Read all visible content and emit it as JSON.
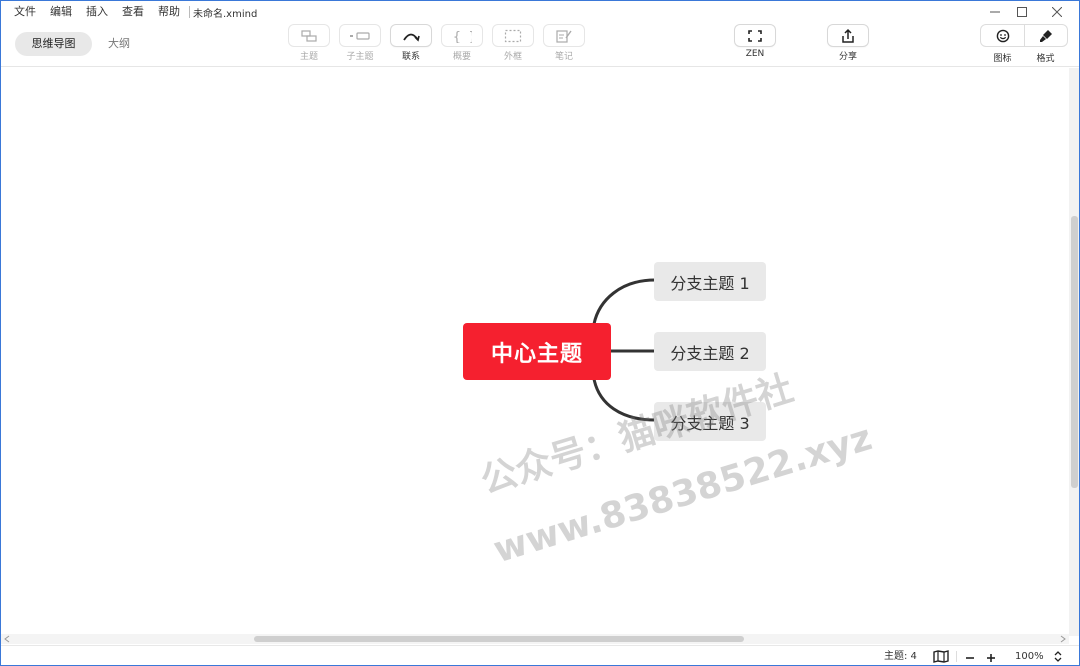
{
  "menubar": {
    "items": [
      "文件",
      "编辑",
      "插入",
      "查看",
      "帮助"
    ],
    "document_title": "未命名.xmind"
  },
  "view_switch": {
    "mindmap": "思维导图",
    "outline": "大纲"
  },
  "toolbar": {
    "topic": "主题",
    "subtopic": "子主题",
    "relationship": "联系",
    "summary": "概要",
    "boundary": "外框",
    "note": "笔记",
    "zen": "ZEN",
    "share": "分享",
    "icon": "图标",
    "format": "格式"
  },
  "mindmap": {
    "central_topic": "中心主题",
    "central_color": "#f5202f",
    "branches": [
      "分支主题 1",
      "分支主题 2",
      "分支主题 3"
    ]
  },
  "watermark": {
    "line1": "公众号：猫咪软件社",
    "line2": "www.83838522.xyz"
  },
  "statusbar": {
    "topic_count": "主题: 4",
    "zoom": "100%"
  }
}
